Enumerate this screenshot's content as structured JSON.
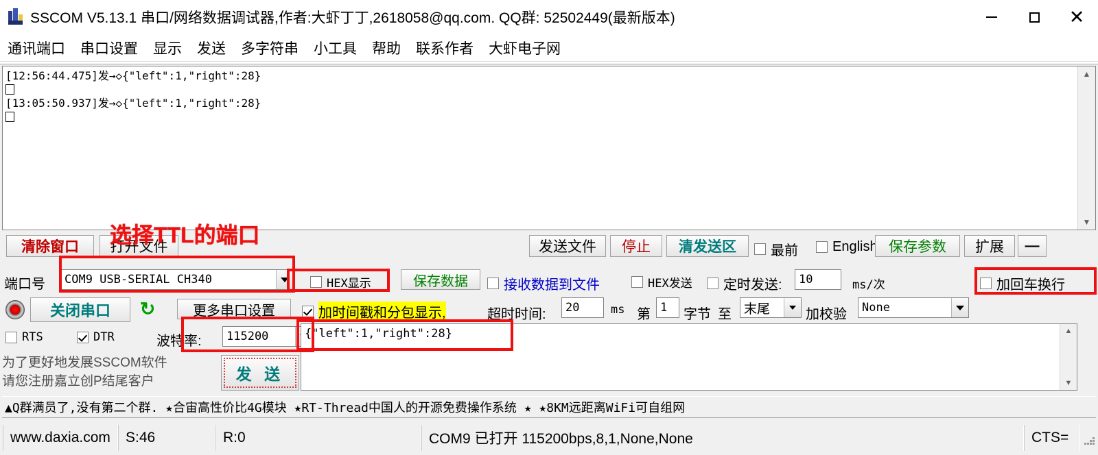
{
  "window": {
    "title": "SSCOM V5.13.1 串口/网络数据调试器,作者:大虾丁丁,2618058@qq.com. QQ群: 52502449(最新版本)",
    "minimize": "",
    "maximize": "",
    "close": "✕"
  },
  "menu": {
    "items": [
      {
        "label": "通讯端口"
      },
      {
        "label": "串口设置"
      },
      {
        "label": "显示"
      },
      {
        "label": "发送"
      },
      {
        "label": "多字符串"
      },
      {
        "label": "小工具"
      },
      {
        "label": "帮助"
      },
      {
        "label": "联系作者"
      },
      {
        "label": "大虾电子网"
      }
    ]
  },
  "receive": {
    "lines": [
      "[12:56:44.475]发→◇{\"left\":1,\"right\":28}",
      "[13:05:50.937]发→◇{\"left\":1,\"right\":28}"
    ],
    "line1": "[12:56:44.475]发→◇{\"left\":1,\"right\":28}",
    "line2": "[13:05:50.937]发→◇{\"left\":1,\"right\":28}",
    "scroll_up": "▲",
    "scroll_down": "▼"
  },
  "toolbar": {
    "clear_window": "清除窗口",
    "open_file": "打开文件",
    "send_file": "发送文件",
    "stop": "停止",
    "clear_send": "清发送区",
    "topmost": "最前",
    "english": "English",
    "save_params": "保存参数",
    "expand": "扩展",
    "minus": "—"
  },
  "settings": {
    "port_label": "端口号",
    "port_value": "COM9 USB-SERIAL CH340",
    "hex_display": "HEX显示",
    "save_data": "保存数据",
    "recv_to_file": "接收数据到文件",
    "hex_send": "HEX发送",
    "timed_send": "定时发送:",
    "timed_value": "10",
    "ms_per": "ms/次",
    "add_crlf": "加回车换行",
    "close_port": "关闭串口",
    "refresh_icon": "refresh",
    "more_settings": "更多串口设置",
    "timestamp": "加时间戳和分包显示,",
    "timeout_label": "超时时间:",
    "timeout_value": "20",
    "ms": "ms",
    "byte_prefix": "第",
    "byte_value": "1",
    "byte_unit": "字节",
    "byte_to": "至",
    "byte_end": "末尾",
    "checksum_label": "加校验",
    "checksum_value": "None",
    "rts": "RTS",
    "dtr": "DTR",
    "baud_label": "波特率:",
    "baud_value": "115200"
  },
  "send_area": {
    "text": "{\"left\":1,\"right\":28}",
    "scroll_up": "▲",
    "scroll_down": "▼"
  },
  "promo": {
    "line1": "为了更好地发展SSCOM软件",
    "line2": "请您注册嘉立创P结尾客户",
    "send_button": "发 送"
  },
  "adbar": {
    "text": "▲Q群满员了,没有第二个群. ★合宙高性价比4G模块 ★RT-Thread中国人的开源免费操作系统 ★ ★8KM远距离WiFi可自组网"
  },
  "statusbar": {
    "site": "www.daxia.com",
    "sent": "S:46",
    "received": "R:0",
    "connection": "COM9 已打开  115200bps,8,1,None,None",
    "cts": "CTS="
  },
  "annotations": {
    "select_ttl_port": "选择TTL的端口",
    "accent_color": "#ee1111"
  }
}
